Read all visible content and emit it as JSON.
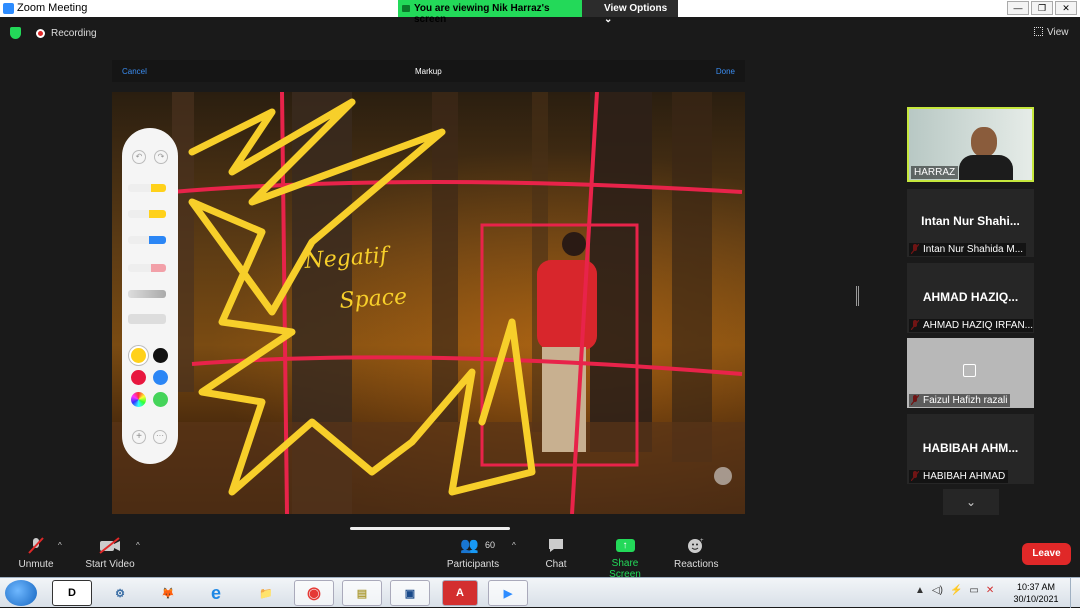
{
  "window": {
    "title": "Zoom Meeting",
    "controls": [
      "—",
      "❐",
      "✕"
    ]
  },
  "banner": {
    "viewing": "You are viewing Nik Harraz's screen",
    "view_options": "View Options ⌄"
  },
  "topbar": {
    "recording": "Recording",
    "view": "View"
  },
  "shared_screen": {
    "markup_bar": {
      "cancel": "Cancel",
      "title": "Markup",
      "done": "Done"
    },
    "handwriting": {
      "line1": "Negatif",
      "line2": "Space"
    },
    "palette": {
      "undo": "↶",
      "redo": "↷",
      "add": "+",
      "more": "···",
      "colors": [
        "#ffd11a",
        "#111111",
        "#e8173f",
        "#2b86f5",
        "#multicolor",
        "#45d45a"
      ]
    }
  },
  "participants_panel": {
    "video_tile": {
      "name": "HARRAZ"
    },
    "tiles": [
      {
        "display": "Intan Nur Shahi...",
        "name": "Intan Nur Shahida M..."
      },
      {
        "display": "AHMAD  HAZIQ...",
        "name": "AHMAD HAZIQ IRFAN..."
      },
      {
        "display": "",
        "name": "Faizul Hafizh razali"
      },
      {
        "display": "HABIBAH  AHM...",
        "name": "HABIBAH AHMAD"
      }
    ],
    "more": "⌄"
  },
  "toolbar": {
    "unmute": "Unmute",
    "start_video": "Start Video",
    "participants": "Participants",
    "participants_count": "60",
    "chat": "Chat",
    "share_screen": "Share Screen",
    "reactions": "Reactions",
    "leave": "Leave",
    "caret": "^"
  },
  "taskbar": {
    "apps": [
      "D",
      "⚙",
      "🦊",
      "e",
      "📁",
      "◉",
      "▤",
      "▣",
      "A",
      "▶"
    ],
    "tray_icons": [
      "▲",
      "◁)",
      "⚡",
      "▭",
      "✕"
    ],
    "time": "10:37 AM",
    "date": "30/10/2021"
  }
}
